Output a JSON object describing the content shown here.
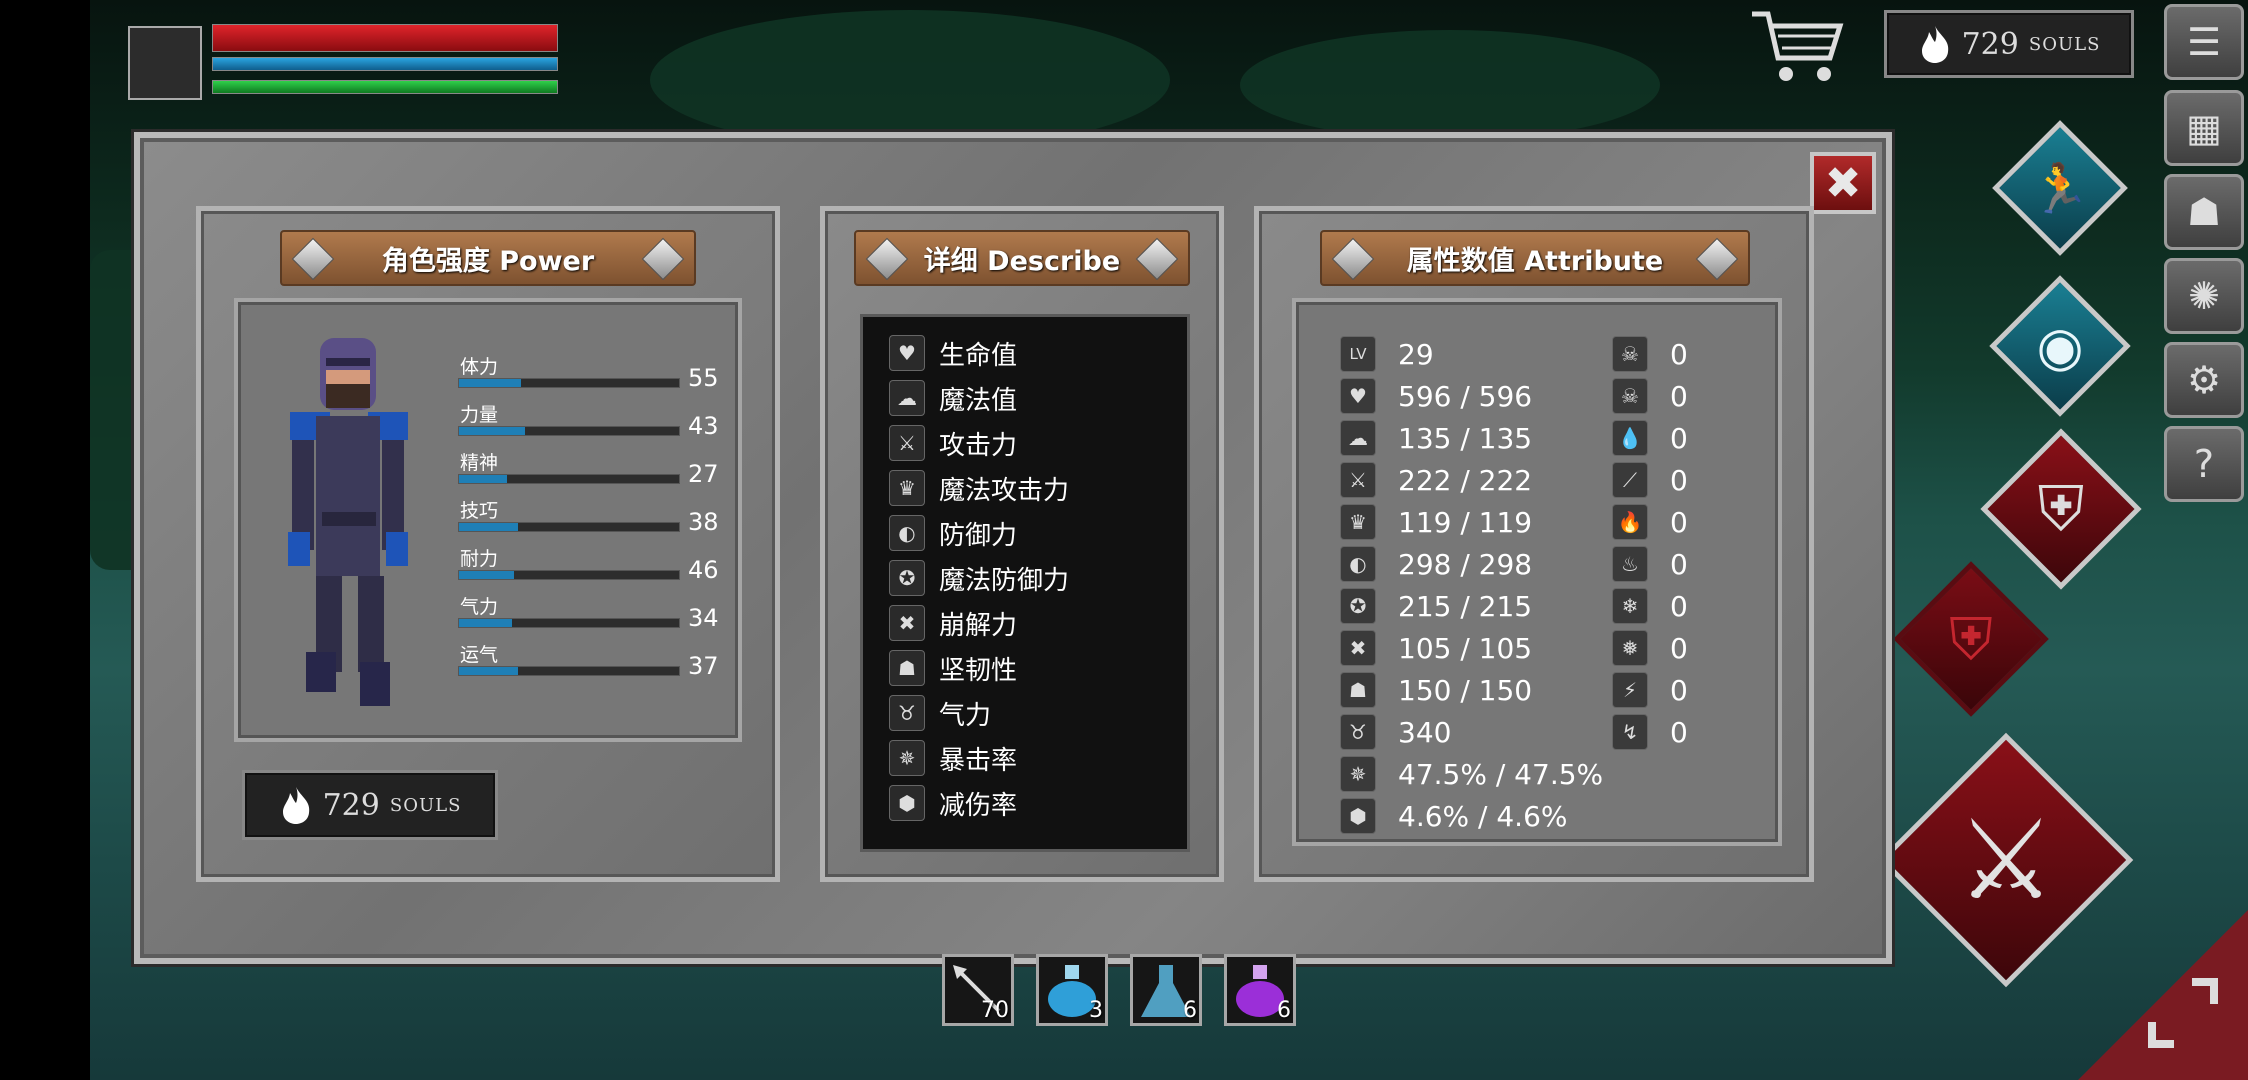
{
  "hud": {
    "souls_value": "729",
    "souls_label": "SOULS"
  },
  "panel": {
    "power": {
      "title": "角色强度 Power",
      "stats": [
        {
          "name": "体力",
          "value": "55",
          "fill": 0.28
        },
        {
          "name": "力量",
          "value": "43",
          "fill": 0.3
        },
        {
          "name": "精神",
          "value": "27",
          "fill": 0.22
        },
        {
          "name": "技巧",
          "value": "38",
          "fill": 0.27
        },
        {
          "name": "耐力",
          "value": "46",
          "fill": 0.25
        },
        {
          "name": "气力",
          "value": "34",
          "fill": 0.24
        },
        {
          "name": "运气",
          "value": "37",
          "fill": 0.27
        }
      ],
      "souls_value": "729",
      "souls_label": "SOULS"
    },
    "describe": {
      "title": "详细 Describe",
      "items": [
        {
          "label": "生命值",
          "icon": "heart-icon"
        },
        {
          "label": "魔法值",
          "icon": "brain-icon"
        },
        {
          "label": "攻击力",
          "icon": "sword-icon"
        },
        {
          "label": "魔法攻击力",
          "icon": "crown-icon"
        },
        {
          "label": "防御力",
          "icon": "shield-icon"
        },
        {
          "label": "魔法防御力",
          "icon": "magic-shield-icon"
        },
        {
          "label": "崩解力",
          "icon": "break-icon"
        },
        {
          "label": "坚韧性",
          "icon": "helmet-icon"
        },
        {
          "label": "气力",
          "icon": "lungs-icon"
        },
        {
          "label": "暴击率",
          "icon": "critical-icon"
        },
        {
          "label": "减伤率",
          "icon": "damage-reduce-icon"
        }
      ]
    },
    "attribute": {
      "title": "属性数值 Attribute",
      "left": [
        {
          "icon": "level-icon",
          "glyph": "LV",
          "value": "29"
        },
        {
          "icon": "heart-icon",
          "glyph": "♥",
          "value": "596 / 596"
        },
        {
          "icon": "brain-icon",
          "glyph": "☁",
          "value": "135 / 135"
        },
        {
          "icon": "sword-icon",
          "glyph": "⚔",
          "value": "222 / 222"
        },
        {
          "icon": "crown-icon",
          "glyph": "♛",
          "value": "119 / 119"
        },
        {
          "icon": "shield-icon",
          "glyph": "◐",
          "value": "298 / 298"
        },
        {
          "icon": "magic-shield-icon",
          "glyph": "✪",
          "value": "215 / 215"
        },
        {
          "icon": "break-icon",
          "glyph": "✖",
          "value": "105 / 105"
        },
        {
          "icon": "helmet-icon",
          "glyph": "☗",
          "value": "150 / 150"
        },
        {
          "icon": "lungs-icon",
          "glyph": "♉",
          "value": "340"
        },
        {
          "icon": "critical-icon",
          "glyph": "✵",
          "value": "47.5% / 47.5%"
        },
        {
          "icon": "damage-reduce-icon",
          "glyph": "⬢",
          "value": "4.6% / 4.6%"
        }
      ],
      "right": [
        {
          "icon": "skull-icon",
          "glyph": "☠",
          "value": "0"
        },
        {
          "icon": "poison-skull-icon",
          "glyph": "☠",
          "value": "0"
        },
        {
          "icon": "water-drop-icon",
          "glyph": "💧",
          "value": "0"
        },
        {
          "icon": "bleed-icon",
          "glyph": "⟋",
          "value": "0"
        },
        {
          "icon": "fire-icon",
          "glyph": "🔥",
          "value": "0"
        },
        {
          "icon": "fire-resist-icon",
          "glyph": "♨",
          "value": "0"
        },
        {
          "icon": "frost-icon",
          "glyph": "❄",
          "value": "0"
        },
        {
          "icon": "frost-resist-icon",
          "glyph": "❅",
          "value": "0"
        },
        {
          "icon": "lightning-icon",
          "glyph": "⚡",
          "value": "0"
        },
        {
          "icon": "lightning-resist-icon",
          "glyph": "↯",
          "value": "0"
        }
      ]
    }
  },
  "inventory": [
    {
      "item": "arrow",
      "count": "70",
      "color": "#dddddd"
    },
    {
      "item": "blue-potion",
      "count": "3",
      "color": "#2f9fd8"
    },
    {
      "item": "flask",
      "count": "6",
      "color": "#5bb7df"
    },
    {
      "item": "purple-potion",
      "count": "6",
      "color": "#9b2fd8"
    }
  ],
  "colors": {
    "accent_red": "#8a1018",
    "stat_bar": "#1f7fb6",
    "hp": "#d81f26",
    "mp": "#1f8cc6",
    "stamina": "#24b03a"
  }
}
